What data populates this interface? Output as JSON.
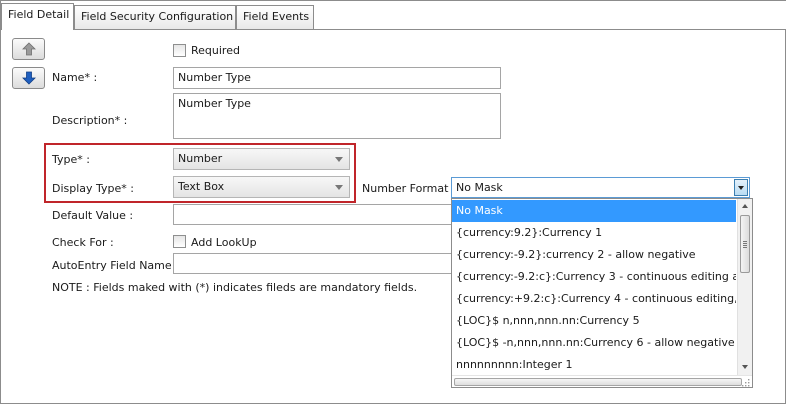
{
  "tabs": [
    {
      "label": "Field Detail",
      "active": true
    },
    {
      "label": "Field Security Configuration",
      "active": false
    },
    {
      "label": "Field Events",
      "active": false
    }
  ],
  "buttons": {
    "move_up_icon": "up-arrow-icon",
    "move_down_icon": "down-arrow-icon"
  },
  "form": {
    "required_label": "Required",
    "required_checked": false,
    "name_label": "Name* :",
    "name_value": "Number Type",
    "description_label": "Description* :",
    "description_value": "Number Type",
    "type_label": "Type* :",
    "type_value": "Number",
    "display_type_label": "Display Type* :",
    "display_type_value": "Text Box",
    "number_format_label": "Number Format :",
    "number_format_value": "No Mask",
    "default_value_label": "Default Value :",
    "default_value": "",
    "check_for_label": "Check For :",
    "add_lookup_label": "Add LookUp",
    "add_lookup_checked": false,
    "autoentry_label": "AutoEntry Field Name :",
    "autoentry_value": "",
    "note": "NOTE : Fields maked with (*) indicates fileds are mandatory fields."
  },
  "number_format_options": [
    "No Mask",
    "{currency:9.2}:Currency 1",
    "{currency:-9.2}:currency 2 - allow negative",
    "{currency:-9.2:c}:Currency 3 - continuous editing a",
    "{currency:+9.2:c}:Currency 4 - continuous editing,",
    "{LOC}$ n,nnn,nnn.nn:Currency 5",
    "{LOC}$ -n,nnn,nnn.nn:Currency 6 - allow negative",
    "nnnnnnnnn:Integer 1"
  ],
  "colors": {
    "highlight": "#c0252a",
    "selection": "#3399ff",
    "focus_border": "#5b9bd5"
  }
}
